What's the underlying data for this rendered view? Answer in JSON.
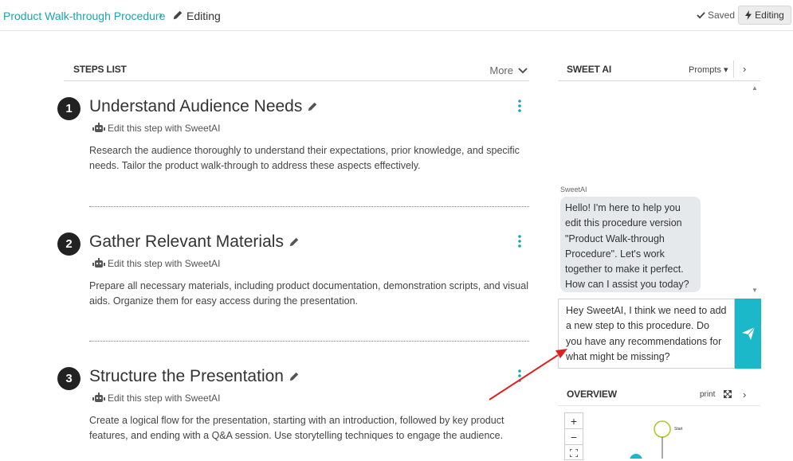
{
  "breadcrumb": {
    "parent": "Product Walk-through Procedure",
    "separator": "›",
    "current": "Editing"
  },
  "status": {
    "saved": "Saved",
    "editing_button": "Editing"
  },
  "steps_panel": {
    "title": "STEPS LIST",
    "more": "More",
    "steps": [
      {
        "number": "1",
        "title": "Understand Audience Needs",
        "ai_link": "Edit this step with SweetAI",
        "description": "Research the audience thoroughly to understand their expectations, prior knowledge, and specific needs. Tailor the product walk-through to address these aspects effectively."
      },
      {
        "number": "2",
        "title": "Gather Relevant Materials",
        "ai_link": "Edit this step with SweetAI",
        "description": "Prepare all necessary materials, including product documentation, demonstration scripts, and visual aids. Organize them for easy access during the presentation."
      },
      {
        "number": "3",
        "title": "Structure the Presentation",
        "ai_link": "Edit this step with SweetAI",
        "description": "Create a logical flow for the presentation, starting with an introduction, followed by key product features, and ending with a Q&A session. Use storytelling techniques to engage the audience."
      }
    ]
  },
  "ai_panel": {
    "title": "SWEET AI",
    "prompts": "Prompts ▾",
    "sender": "SweetAI",
    "message": "Hello! I'm here to help you edit this procedure version \"Product Walk-through Procedure\". Let's work together to make it perfect. How can I assist you today?",
    "input_value": "Hey SweetAI, I think we need to add a new step to this procedure. Do you have any recommendations for what might be missing?"
  },
  "overview": {
    "title": "OVERVIEW",
    "print": "print",
    "zoom_in": "+",
    "zoom_out": "−",
    "start_label": "Start"
  },
  "colors": {
    "accent": "#1aa3b3",
    "send_button": "#1ab8c8",
    "annotation_arrow": "#e02020"
  }
}
